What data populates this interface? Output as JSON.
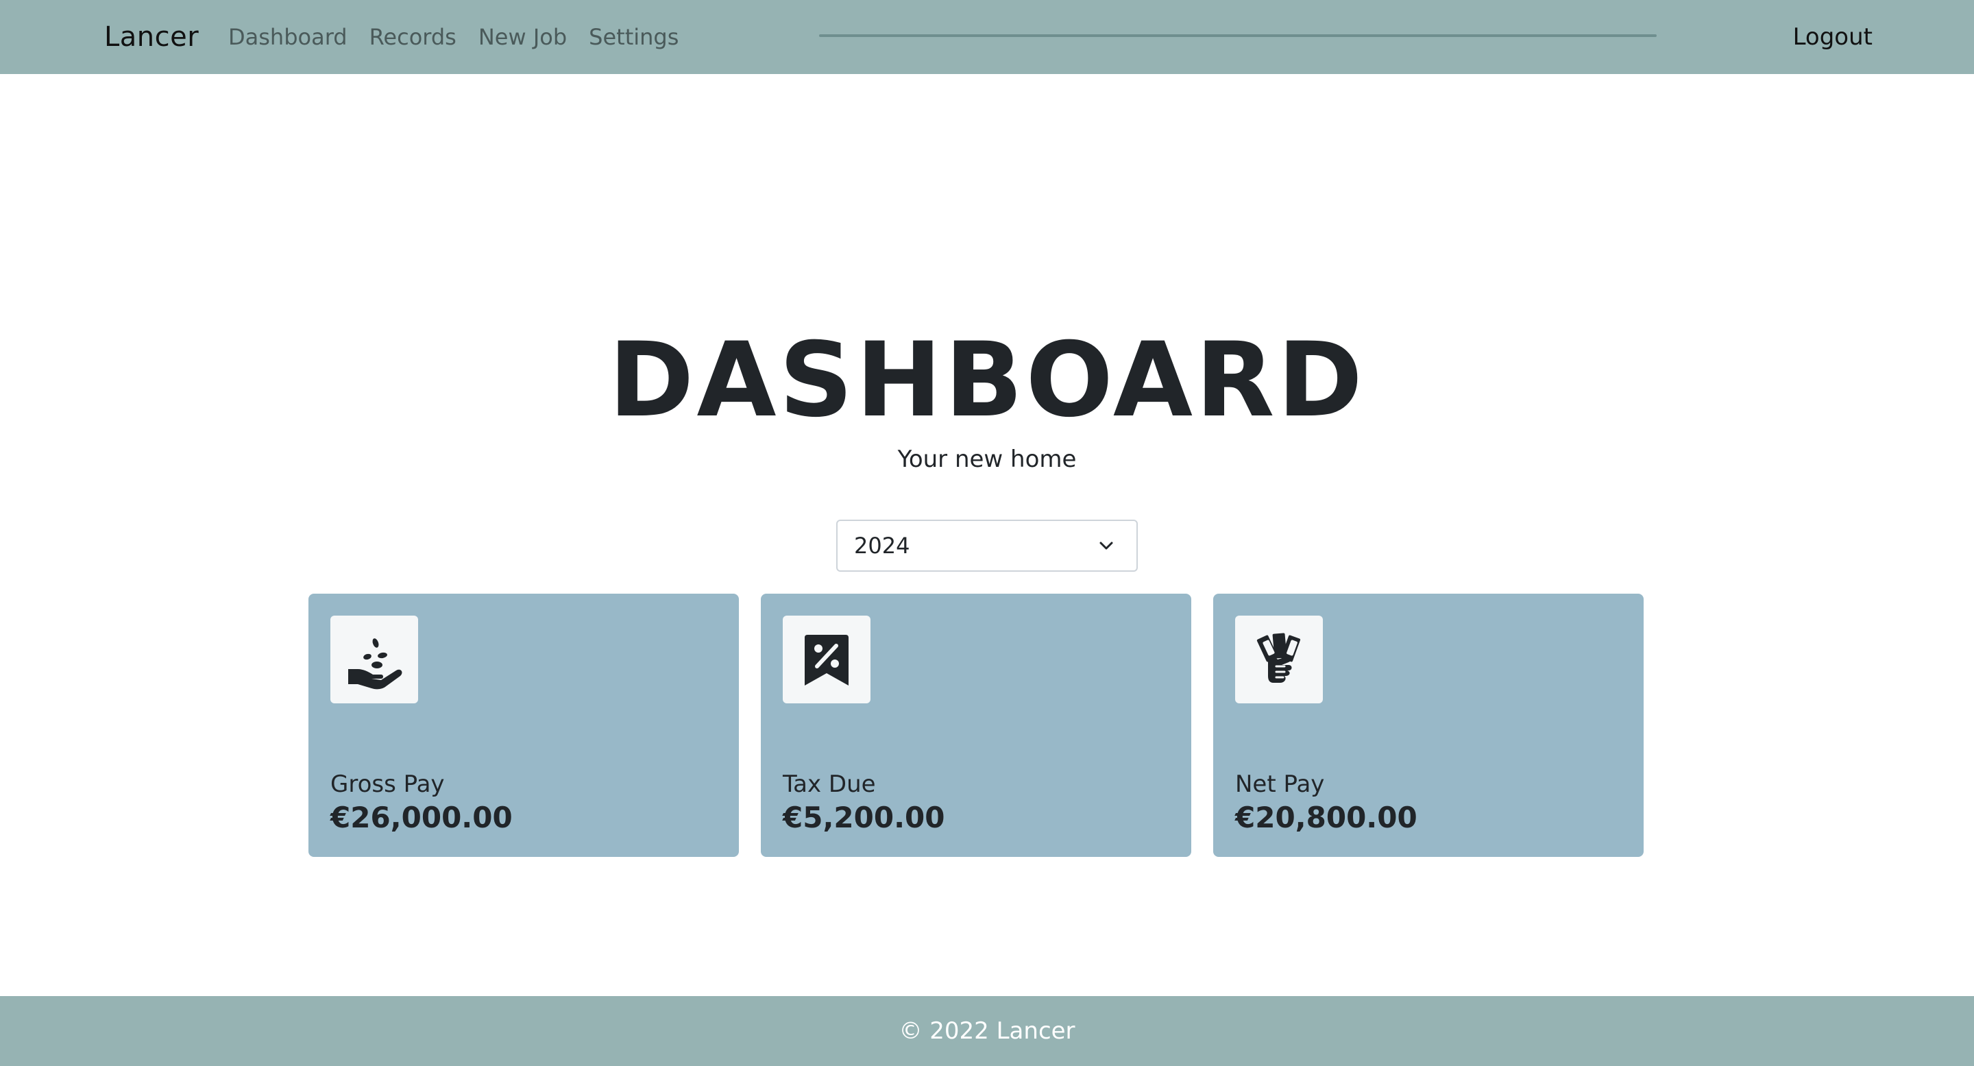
{
  "navbar": {
    "brand": "Lancer",
    "links": [
      {
        "label": "Dashboard"
      },
      {
        "label": "Records"
      },
      {
        "label": "New Job"
      },
      {
        "label": "Settings"
      }
    ],
    "logout_label": "Logout"
  },
  "hero": {
    "title": "DASHBOARD",
    "subtitle": "Your new home"
  },
  "year_select": {
    "selected": "2024"
  },
  "cards": [
    {
      "label": "Gross Pay",
      "value": "€26,000.00",
      "icon": "hand-seeds-icon"
    },
    {
      "label": "Tax Due",
      "value": "€5,200.00",
      "icon": "tax-receipt-icon"
    },
    {
      "label": "Net Pay",
      "value": "€20,800.00",
      "icon": "cash-in-hand-icon"
    }
  ],
  "footer": {
    "text": "© 2022 Lancer"
  },
  "colors": {
    "navbar_bg": "#96b3b3",
    "card_bg": "#98b8c8",
    "footer_bg": "#96b3b3",
    "text_dark": "#212529"
  }
}
